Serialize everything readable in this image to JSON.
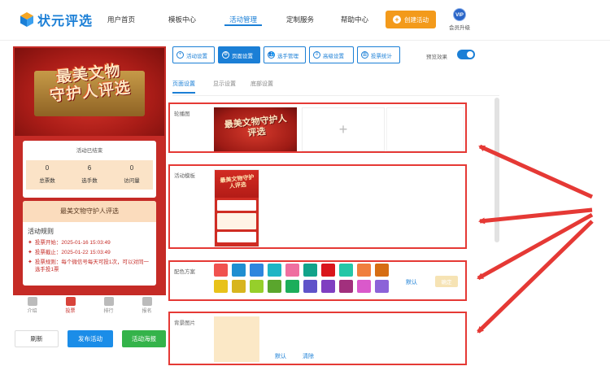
{
  "brand": {
    "name": "状元评选",
    "accent": "#1b7fd6"
  },
  "nav": {
    "items": [
      {
        "label": "用户首页",
        "active": false
      },
      {
        "label": "模板中心",
        "active": false
      },
      {
        "label": "活动管理",
        "active": true
      },
      {
        "label": "定制服务",
        "active": false
      },
      {
        "label": "帮助中心",
        "active": false
      }
    ],
    "create_label": "创建活动",
    "vip_badge": "VIP",
    "vip_label": "会员升级"
  },
  "preview": {
    "banner_title_line1": "最美文物",
    "banner_title_line2": "守护人评选",
    "status": "活动已结束",
    "stats": [
      {
        "value": "0",
        "label": "总票数"
      },
      {
        "value": "6",
        "label": "选手数"
      },
      {
        "value": "0",
        "label": "访问量"
      }
    ],
    "activity_name": "最美文物守护人评选",
    "rules_title": "活动规则",
    "rules": [
      "投票开始：2025-01-16 15:03:49",
      "投票截止：2025-01-22 15:03:49",
      "投票规则：每个微信号每天可投1次，可以对同一选手投1票"
    ],
    "tabs": [
      {
        "label": "介绍",
        "active": false
      },
      {
        "label": "投票",
        "active": true
      },
      {
        "label": "排行",
        "active": false
      },
      {
        "label": "报名",
        "active": false
      }
    ]
  },
  "actions": {
    "refresh": "刷新",
    "publish": "发布活动",
    "poster": "活动海报"
  },
  "toolbar": {
    "buttons": [
      {
        "label": "活动设置",
        "icon": "plus-circle-icon",
        "active": false
      },
      {
        "label": "页面设置",
        "icon": "gear-icon",
        "active": true
      },
      {
        "label": "选手管理",
        "icon": "users-icon",
        "active": false
      },
      {
        "label": "高级设置",
        "icon": "sliders-icon",
        "active": false
      },
      {
        "label": "投票统计",
        "icon": "bar-chart-icon",
        "active": false
      }
    ],
    "preview_label": "预览效果",
    "preview_on": true
  },
  "subtabs": [
    {
      "label": "页面设置",
      "active": true
    },
    {
      "label": "显示设置",
      "active": false
    },
    {
      "label": "底部设置",
      "active": false
    }
  ],
  "sections": {
    "carousel": {
      "label": "轮播图",
      "image_title": "最美文物守护人评选"
    },
    "template": {
      "label": "活动模板",
      "thumb_title": "最美文物守护人评选"
    },
    "colors": {
      "label": "配色方案",
      "row1": [
        "#f0524f",
        "#1f8ed1",
        "#2e86de",
        "#1eb5c5",
        "#ef6fa0",
        "#12a38a",
        "#d9161c",
        "#25c7a7",
        "#f07f3e",
        "#d66d13"
      ],
      "row2": [
        "#e8c21a",
        "#d7b51f",
        "#96cf2b",
        "#5aa62d",
        "#1cae5b",
        "#5f53c9",
        "#7f3fc1",
        "#a2307d",
        "#da59cb",
        "#8c63d8"
      ],
      "default_link": "默认",
      "default_button": "确定"
    },
    "background": {
      "label": "背景图片",
      "default_link": "默认",
      "clear_link": "清除"
    }
  }
}
